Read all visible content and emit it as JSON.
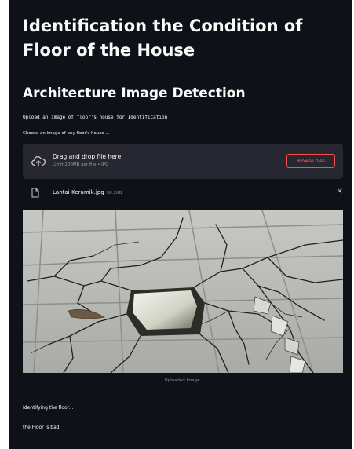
{
  "page": {
    "title": "Identification the Condition of Floor of the House",
    "subtitle": "Architecture Image Detection",
    "instruction": "Upload an image of floor's house for Identification"
  },
  "uploader": {
    "label": "Choose an image of any floor's house ...",
    "drop_title": "Drag and drop file here",
    "limit_text": "Limit 200MB per file • JPG",
    "browse_label": "Browse files",
    "upload_icon": "cloud-upload-icon"
  },
  "file": {
    "name": "Lantai-Keramik.jpg",
    "size": "98.2KB",
    "icon": "file-icon",
    "close": "×"
  },
  "image": {
    "caption": "Uploaded Image."
  },
  "results": {
    "status1": "Identifying the floor...",
    "status2": "the Floor is bad"
  },
  "colors": {
    "background": "#0e1117",
    "dropzone": "#262730",
    "accent": "#ff4b4b",
    "text": "#fafafa"
  }
}
